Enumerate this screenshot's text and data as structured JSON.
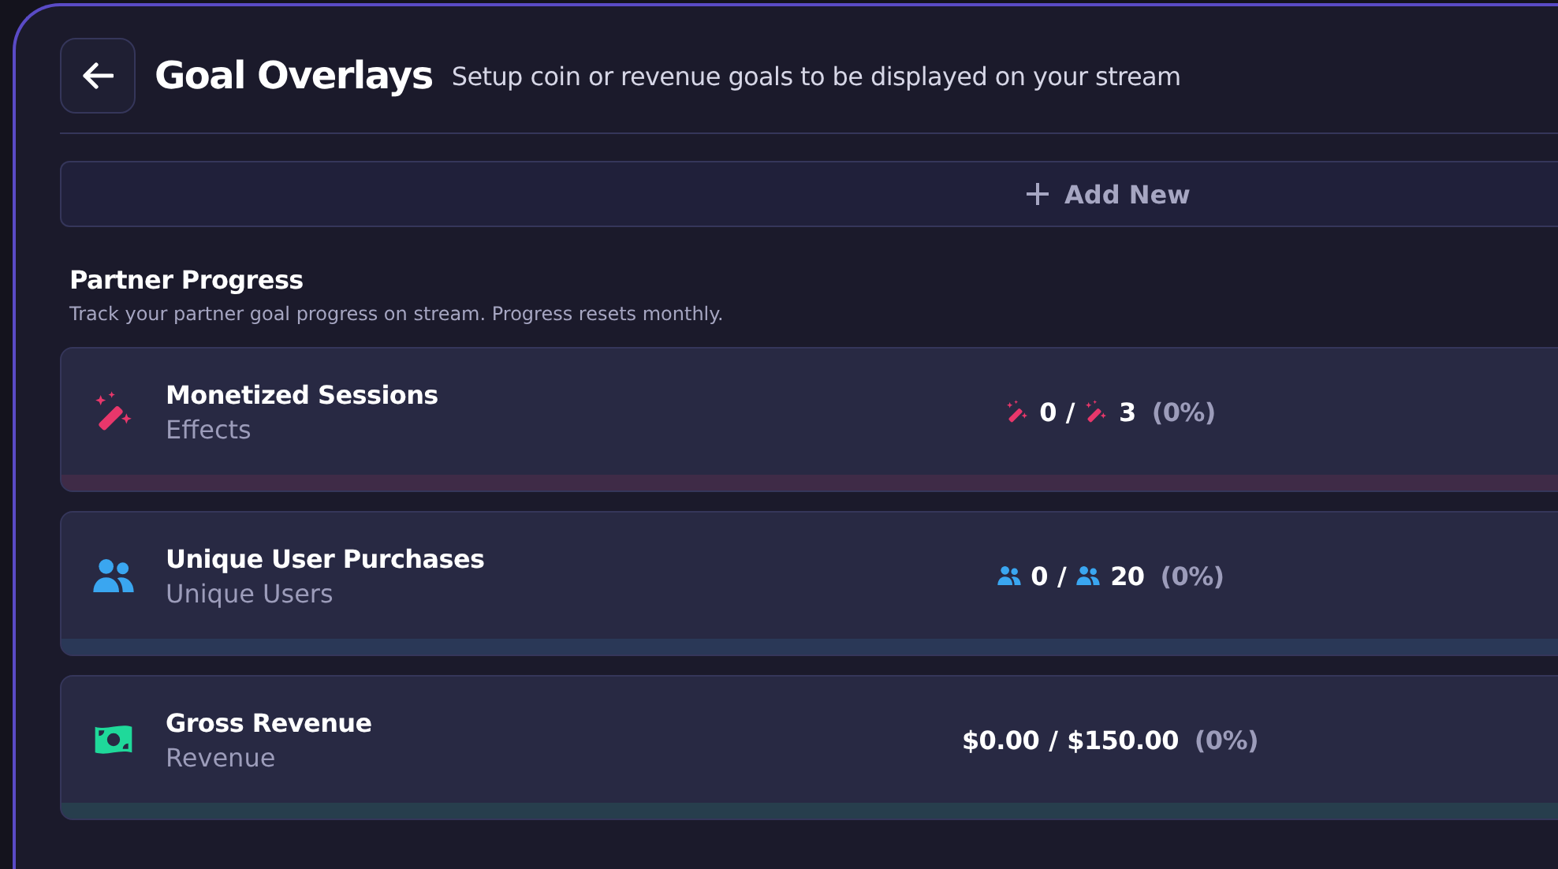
{
  "header": {
    "title": "Goal Overlays",
    "subtitle": "Setup coin or revenue goals to be displayed on your stream"
  },
  "add_button": {
    "label": "Add New"
  },
  "section": {
    "title": "Partner Progress",
    "description": "Track your partner goal progress on stream. Progress resets monthly."
  },
  "goals": [
    {
      "kind": "effects",
      "title": "Monetized Sessions",
      "subtitle": "Effects",
      "color": "#e8376b",
      "current": "0",
      "separator": "/",
      "target": "3",
      "percent": "(0%)",
      "value_icons": true,
      "level": 0
    },
    {
      "kind": "users",
      "title": "Unique User Purchases",
      "subtitle": "Unique Users",
      "color": "#3aa6f0",
      "current": "0",
      "separator": "/",
      "target": "20",
      "percent": "(0%)",
      "value_icons": true,
      "level": 0
    },
    {
      "kind": "revenue",
      "title": "Gross Revenue",
      "subtitle": "Revenue",
      "color": "#1fd99a",
      "current": "$0.00",
      "separator": "/",
      "target": "$150.00",
      "percent": "(0%)",
      "value_icons": false,
      "level": 0
    }
  ]
}
